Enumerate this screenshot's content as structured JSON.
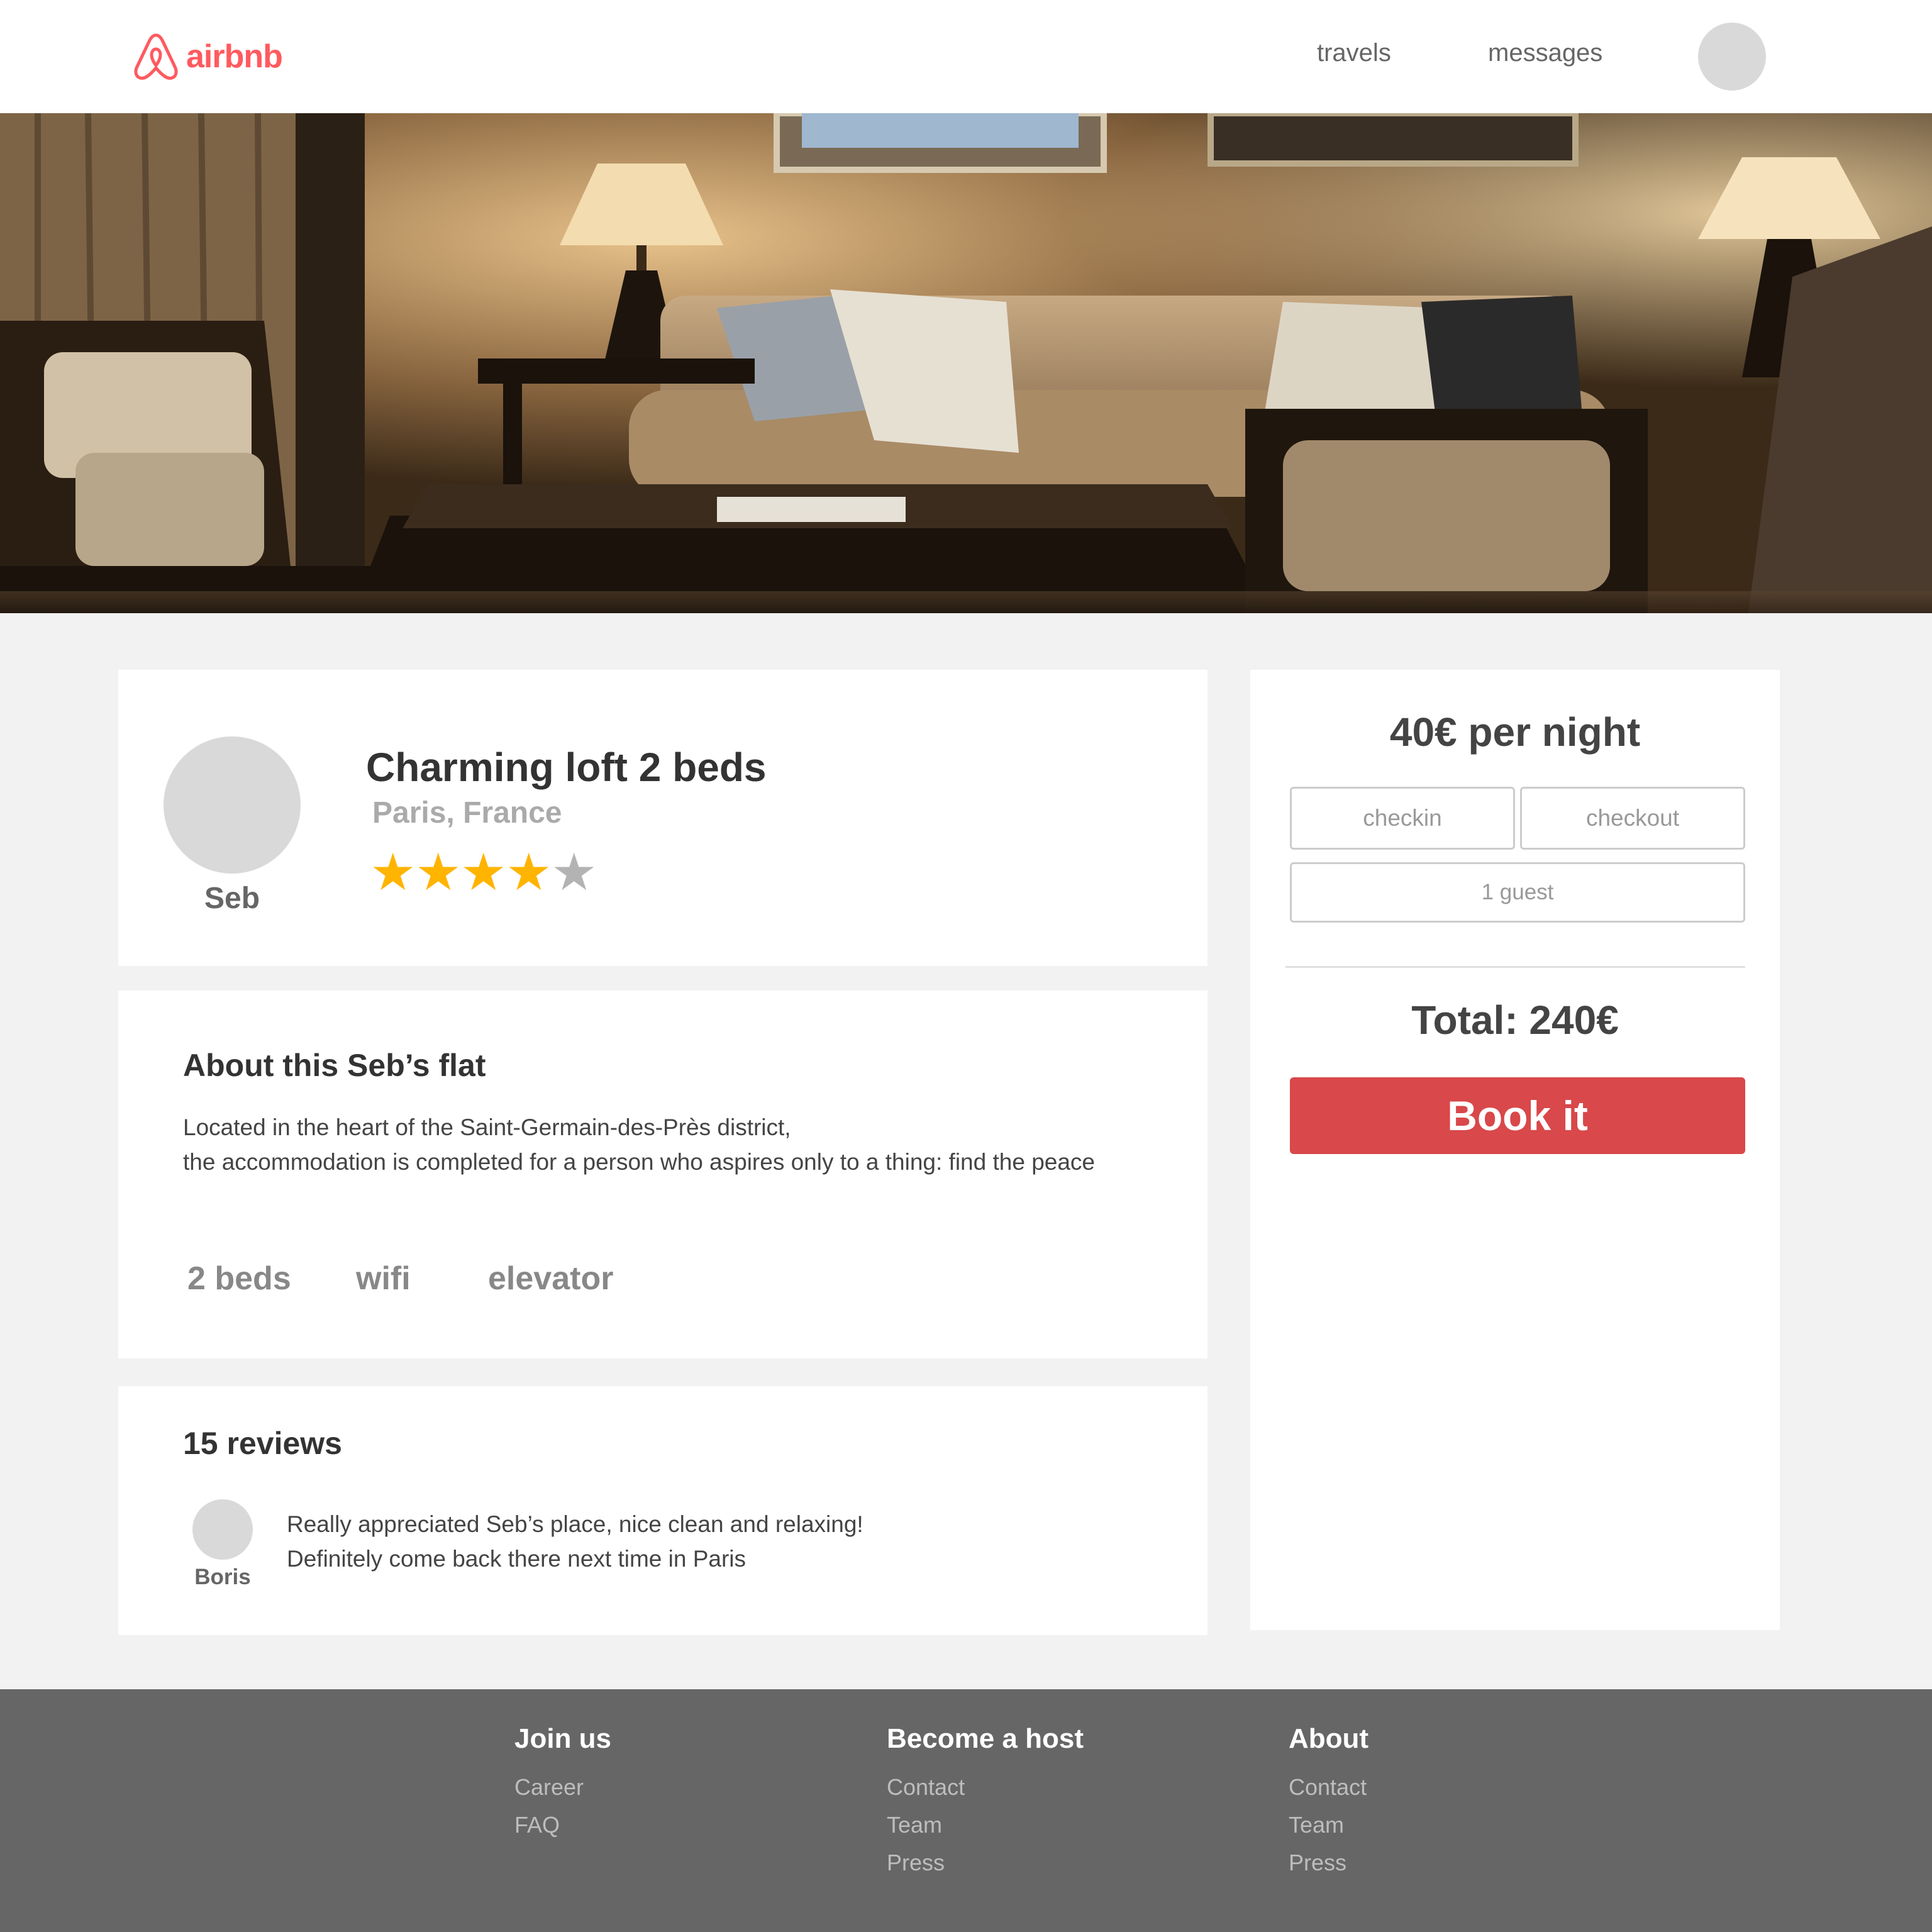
{
  "header": {
    "logo_text": "airbnb",
    "nav": {
      "travels": "travels",
      "messages": "messages"
    }
  },
  "listing": {
    "host_name": "Seb",
    "title": "Charming loft 2 beds",
    "location": "Paris, France",
    "rating": 4,
    "rating_max": 5
  },
  "about": {
    "title": "About this Seb’s flat",
    "description_line1": "Located in the heart of the Saint-Germain-des-Près district,",
    "description_line2": "the accommodation is completed for a person who aspires only to a thing: find the peace",
    "amenities": [
      "2 beds",
      "wifi",
      "elevator"
    ]
  },
  "reviews": {
    "title": "15 reviews",
    "items": [
      {
        "author": "Boris",
        "line1": "Really appreciated Seb’s place, nice clean and relaxing!",
        "line2": "Definitely come back there next time in Paris"
      }
    ]
  },
  "booking": {
    "price": "40€ per night",
    "checkin_placeholder": "checkin",
    "checkout_placeholder": "checkout",
    "guests_placeholder": "1 guest",
    "total": "Total: 240€",
    "book_label": "Book it"
  },
  "footer": {
    "columns": [
      {
        "heading": "Join us",
        "links": [
          "Career",
          "FAQ"
        ]
      },
      {
        "heading": "Become a host",
        "links": [
          "Contact",
          "Team",
          "Press"
        ]
      },
      {
        "heading": "About",
        "links": [
          "Contact",
          "Team",
          "Press"
        ]
      }
    ]
  },
  "colors": {
    "brand": "#ff5a5f",
    "book_button": "#d9484a",
    "star_on": "#ffb400",
    "star_off": "#b3b3b3",
    "footer_bg": "#666666"
  },
  "icons": {
    "logo": "airbnb-belo-icon",
    "star": "star-icon"
  }
}
